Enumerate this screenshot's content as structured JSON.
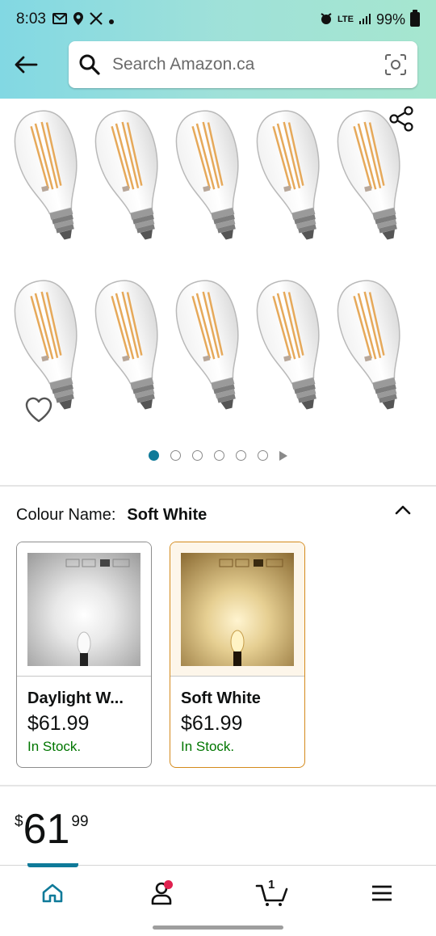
{
  "status_bar": {
    "time": "8:03",
    "left_icons": [
      "mail-icon",
      "location-icon",
      "x-icon",
      "dot-icon"
    ],
    "right_icons": [
      "alarm-icon",
      "lte-icon",
      "signal-icon"
    ],
    "network": "LTE",
    "battery": "99%"
  },
  "header": {
    "search_placeholder": "Search Amazon.ca"
  },
  "gallery": {
    "dot_count": 6,
    "active_index": 0
  },
  "colour": {
    "label": "Colour Name:",
    "selected": "Soft White"
  },
  "variants": [
    {
      "name": "Daylight W...",
      "price": "$61.99",
      "stock": "In Stock.",
      "selected": false
    },
    {
      "name": "Soft White",
      "price": "$61.99",
      "stock": "In Stock.",
      "selected": true
    }
  ],
  "price": {
    "currency": "$",
    "whole": "61",
    "fraction": "99"
  },
  "bottom_nav": {
    "items": [
      "home-icon",
      "account-icon",
      "cart-icon",
      "menu-icon"
    ],
    "cart_count": "1"
  },
  "colors": {
    "accent": "#0f7a99",
    "stock_green": "#007600",
    "selected_border": "#d48a1c"
  }
}
